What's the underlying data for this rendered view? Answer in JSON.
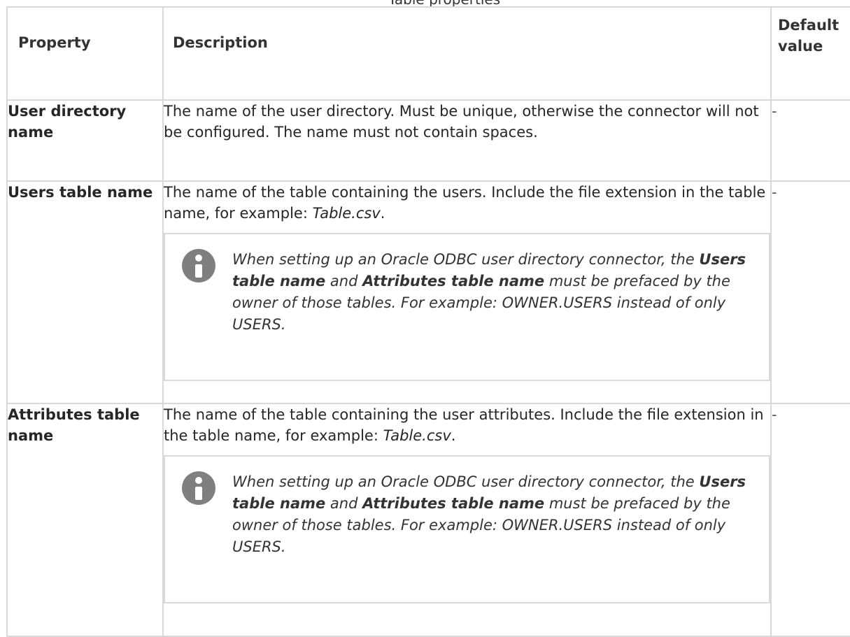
{
  "header": {
    "property": "Property",
    "description": "Description",
    "default_value": "Default value"
  },
  "rows": [
    {
      "property": "User directory name",
      "description": "The name of the user directory. Must be unique, otherwise the connector will not be configured. The name must not contain spaces.",
      "default": "-"
    },
    {
      "property": "Users table name",
      "description_prefix": "The name of the table containing the users. Include the file extension in the table name, for example: ",
      "description_example": "Table.csv",
      "description_suffix": ".",
      "default": "-",
      "note": {
        "icon": "info-icon",
        "text_1": "When setting up an Oracle ODBC user directory connector, the ",
        "bold_1": "Users table name",
        "text_2": " and ",
        "bold_2": "Attributes table name",
        "text_3": " must be prefaced by the owner of those tables. For example: OWNER.USERS instead of only USERS."
      }
    },
    {
      "property": "Attributes table name",
      "description_prefix": "The name of the table containing the user attributes. Include the file extension in the table name, for example: ",
      "description_example": "Table.csv",
      "description_suffix": ".",
      "default": "-",
      "note": {
        "icon": "info-icon",
        "text_1": "When setting up an Oracle ODBC user directory connector, the ",
        "bold_1": "Users table name",
        "text_2": " and ",
        "bold_2": "Attributes table name",
        "text_3": " must be prefaced by the owner of those tables. For example: OWNER.USERS instead of only USERS."
      }
    }
  ]
}
